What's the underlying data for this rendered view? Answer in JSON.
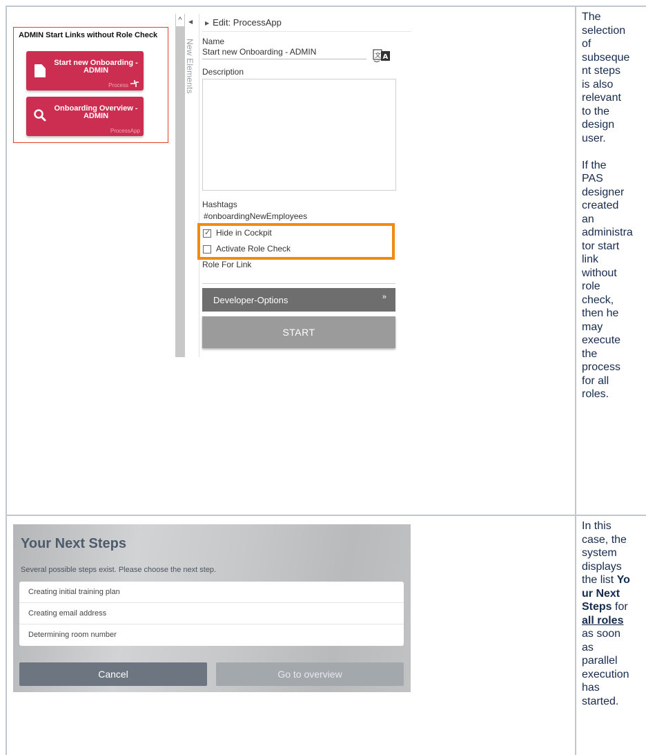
{
  "admin_panel": {
    "title": "ADMIN Start Links without Role Check",
    "tiles": [
      {
        "label": "Start new Onboarding - ADMIN",
        "sublabel": "Process",
        "icon": "document-icon"
      },
      {
        "label": "Onboarding Overview - ADMIN",
        "sublabel": "ProcessApp",
        "icon": "search-icon"
      }
    ]
  },
  "sidebar": {
    "vertical_label": "New Elements"
  },
  "edit_panel": {
    "title": "Edit: ProcessApp",
    "name_label": "Name",
    "name_value": "Start new Onboarding - ADMIN",
    "description_label": "Description",
    "description_value": "",
    "hashtags_label": "Hashtags",
    "hashtags_value": "#onboardingNewEmployees",
    "hide_in_cockpit_label": "Hide in Cockpit",
    "hide_in_cockpit_checked": true,
    "activate_role_check_label": "Activate Role Check",
    "activate_role_check_checked": false,
    "role_for_link_label": "Role For Link",
    "developer_options_label": "Developer-Options",
    "start_label": "START"
  },
  "notes": {
    "note1_p1": [
      "The",
      "selection",
      "of",
      "subseque",
      "nt steps",
      "is also",
      "relevant",
      "to the",
      "design",
      "user."
    ],
    "note1_p2": [
      "If the",
      "PAS",
      "designer",
      "created",
      "an",
      "administra",
      "tor start",
      "link",
      "without",
      "role",
      "check,",
      "then he",
      "may",
      "execute",
      "the",
      "process",
      "for all",
      "roles."
    ],
    "note2": {
      "l1": "In this",
      "l2": "case, the",
      "l3": "system",
      "l4": "displays",
      "l5a": "the list ",
      "l5b": "Yo",
      "l6a": "ur Next",
      "l7a": "Steps",
      "l7b": " for",
      "l8": "all roles",
      "l9": "as soon",
      "l10": "as",
      "l11": "parallel",
      "l12": "execution",
      "l13": "has",
      "l14": "started."
    }
  },
  "next_steps": {
    "title": "Your Next Steps",
    "subtitle": "Several possible steps exist. Please choose the next step.",
    "items": [
      "Creating initial training plan",
      "Creating email address",
      "Determining room number"
    ],
    "cancel_label": "Cancel",
    "overview_label": "Go to overview"
  },
  "colors": {
    "tile": "#cc2e52",
    "highlight": "#f08a10",
    "admin_border": "#e0402a",
    "dev_bar": "#6e6e6e",
    "start_button": "#9b9b9b"
  }
}
